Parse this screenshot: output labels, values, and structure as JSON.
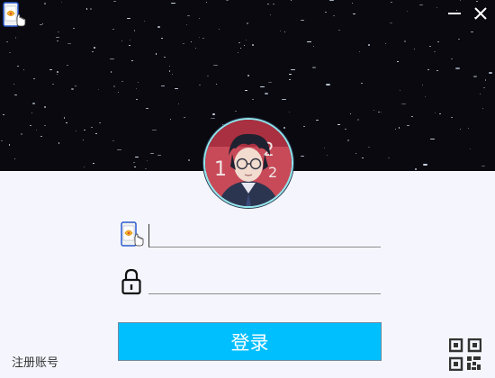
{
  "window": {
    "app_icon": "phone-touch-icon",
    "minimize_icon": "minimize-icon",
    "close_icon": "close-icon"
  },
  "profile": {
    "avatar": "avatar"
  },
  "form": {
    "username_icon": "phone-touch-icon",
    "username_value": "",
    "password_icon": "lock-icon",
    "password_value": "",
    "login_label": "登录"
  },
  "footer": {
    "register_label": "注册账号",
    "qr_icon": "qr-code-icon"
  },
  "colors": {
    "header_bg": "#0a0910",
    "page_bg": "#f5f6fd",
    "accent": "#00bfff",
    "avatar_ring": "#8fe6ec"
  }
}
